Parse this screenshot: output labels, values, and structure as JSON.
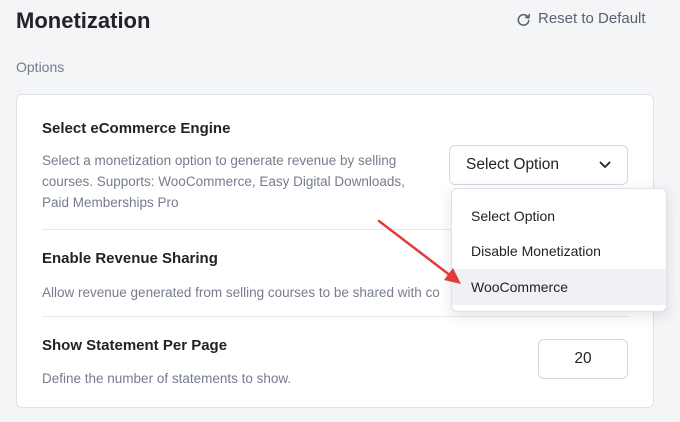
{
  "header": {
    "title": "Monetization",
    "reset_label": "Reset to Default"
  },
  "section": {
    "label": "Options"
  },
  "ecommerce_engine": {
    "title": "Select eCommerce Engine",
    "description_lines": [
      "Select a monetization option to generate revenue by selling",
      "courses. Supports: WooCommerce, Easy Digital Downloads,",
      "Paid Memberships Pro"
    ],
    "selected_value": "Select Option",
    "dropdown_open": true,
    "options": [
      {
        "label": "Select Option",
        "highlighted": false
      },
      {
        "label": "Disable Monetization",
        "highlighted": false
      },
      {
        "label": "WooCommerce",
        "highlighted": true
      }
    ]
  },
  "revenue_sharing": {
    "title": "Enable Revenue Sharing",
    "description": "Allow revenue generated from selling courses to be shared with co"
  },
  "statement_per_page": {
    "title": "Show Statement Per Page",
    "description": "Define the number of statements to show.",
    "value": "20"
  },
  "annotation": {
    "arrow_color": "#e03c3c",
    "points_to": "WooCommerce"
  },
  "colors": {
    "background": "#f4f5f7",
    "card": "#ffffff",
    "text_primary": "#212327",
    "text_secondary": "#757c8e",
    "highlight": "#eff1f6"
  }
}
